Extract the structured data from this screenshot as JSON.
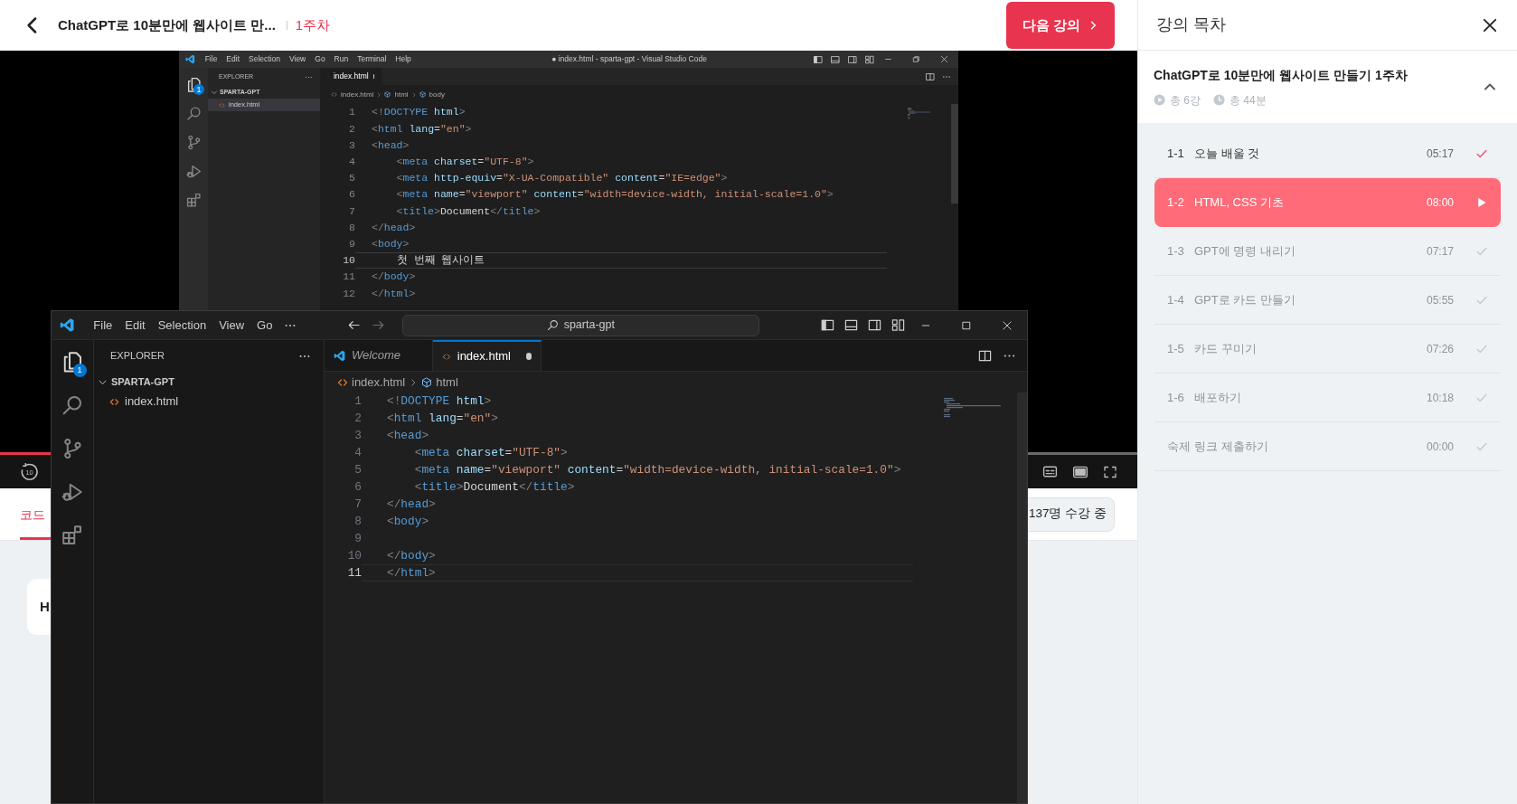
{
  "top_bar": {
    "course_title": "ChatGPT로 10분만에 웹사이트 만...",
    "week": "1주차",
    "next_button": "다음 강의"
  },
  "video": {
    "progress": {
      "level": 0.35
    },
    "rewind_label": "10",
    "recording": {
      "title": "● index.html - sparta-gpt - Visual Studio Code",
      "menu": [
        "File",
        "Edit",
        "Selection",
        "View",
        "Go",
        "Run",
        "Terminal",
        "Help"
      ],
      "menu_overflow": false,
      "explorer": "EXPLORER",
      "badge": "1",
      "folder": "SPARTA-GPT",
      "files": [
        {
          "name": "index.html",
          "selected": true
        }
      ],
      "tabs": [
        {
          "kind": "file",
          "label": "index.html",
          "modified": true,
          "selected": true
        }
      ],
      "breadcrumb": [
        "index.html",
        "html",
        "body"
      ],
      "lines": [
        {
          "number": "1",
          "text": "<!DOCTYPE html>",
          "active": false
        },
        {
          "number": "2",
          "text": "<html lang=\"en\">",
          "active": false
        },
        {
          "number": "3",
          "text": "<head>",
          "active": false
        },
        {
          "number": "4",
          "text": "    <meta charset=\"UTF-8\">",
          "active": false
        },
        {
          "number": "5",
          "text": "    <meta http-equiv=\"X-UA-Compatible\" content=\"IE=edge\">",
          "active": false
        },
        {
          "number": "6",
          "text": "    <meta name=\"viewport\" content=\"width=device-width, initial-scale=1.0\">",
          "active": false
        },
        {
          "number": "7",
          "text": "    <title>Document</title>",
          "active": false
        },
        {
          "number": "8",
          "text": "</head>",
          "active": false
        },
        {
          "number": "9",
          "text": "<body>",
          "active": false
        },
        {
          "number": "10",
          "text": "    첫 번째 웹사이트",
          "active": true
        },
        {
          "number": "11",
          "text": "</body>",
          "active": false
        },
        {
          "number": "12",
          "text": "</html>",
          "active": false
        }
      ]
    }
  },
  "content_tabs": [
    {
      "label": "코드",
      "selected": true
    }
  ],
  "enrolled": "137명 수강 중",
  "card": {
    "text": "H"
  },
  "editor_window": {
    "search": "sparta-gpt",
    "menu": [
      "File",
      "Edit",
      "Selection",
      "View",
      "Go"
    ],
    "menu_overflow": true,
    "explorer": "EXPLORER",
    "badge": "1",
    "folder": "SPARTA-GPT",
    "files": [
      {
        "name": "index.html",
        "selected": false
      }
    ],
    "tabs": [
      {
        "kind": "welcome",
        "label": "Welcome",
        "modified": false,
        "selected": false
      },
      {
        "kind": "file",
        "label": "index.html",
        "modified": true,
        "selected": true
      }
    ],
    "breadcrumb": [
      "index.html",
      "html"
    ],
    "lines": [
      {
        "number": "1",
        "text": "<!DOCTYPE html>",
        "active": false
      },
      {
        "number": "2",
        "text": "<html lang=\"en\">",
        "active": false
      },
      {
        "number": "3",
        "text": "<head>",
        "active": false
      },
      {
        "number": "4",
        "text": "    <meta charset=\"UTF-8\">",
        "active": false
      },
      {
        "number": "5",
        "text": "    <meta name=\"viewport\" content=\"width=device-width, initial-scale=1.0\">",
        "active": false
      },
      {
        "number": "6",
        "text": "    <title>Document</title>",
        "active": false
      },
      {
        "number": "7",
        "text": "</head>",
        "active": false
      },
      {
        "number": "8",
        "text": "<body>",
        "active": false
      },
      {
        "number": "9",
        "active": false
      },
      {
        "number": "10",
        "text": "</body>",
        "active": false
      },
      {
        "number": "11",
        "text": "</html>",
        "active": true
      }
    ]
  },
  "toc": {
    "title": "강의 목차",
    "section": {
      "title": "ChatGPT로 10분만에 웹사이트 만들기 1주차",
      "expanded": true,
      "meta": [
        {
          "kind": "lessons",
          "text": "총 6강"
        },
        {
          "kind": "duration",
          "text": "총 44분"
        }
      ],
      "lessons": [
        {
          "number": "1-1",
          "title": "오늘 배울 것",
          "time": "05:17",
          "selected": false,
          "completed": true
        },
        {
          "number": "1-2",
          "title": "HTML, CSS 기초",
          "time": "08:00",
          "selected": true,
          "completed": false
        },
        {
          "number": "1-3",
          "title": "GPT에 명령 내리기",
          "time": "07:17",
          "selected": false,
          "completed": false
        },
        {
          "number": "1-4",
          "title": "GPT로 카드 만들기",
          "time": "05:55",
          "selected": false,
          "completed": false
        },
        {
          "number": "1-5",
          "title": "카드 꾸미기",
          "time": "07:26",
          "selected": false,
          "completed": false
        },
        {
          "number": "1-6",
          "title": "배포하기",
          "time": "10:18",
          "selected": false,
          "completed": false
        },
        {
          "number": "숙제",
          "title": "링크 제출하기",
          "time": "00:00",
          "selected": false,
          "completed": false
        }
      ]
    }
  }
}
